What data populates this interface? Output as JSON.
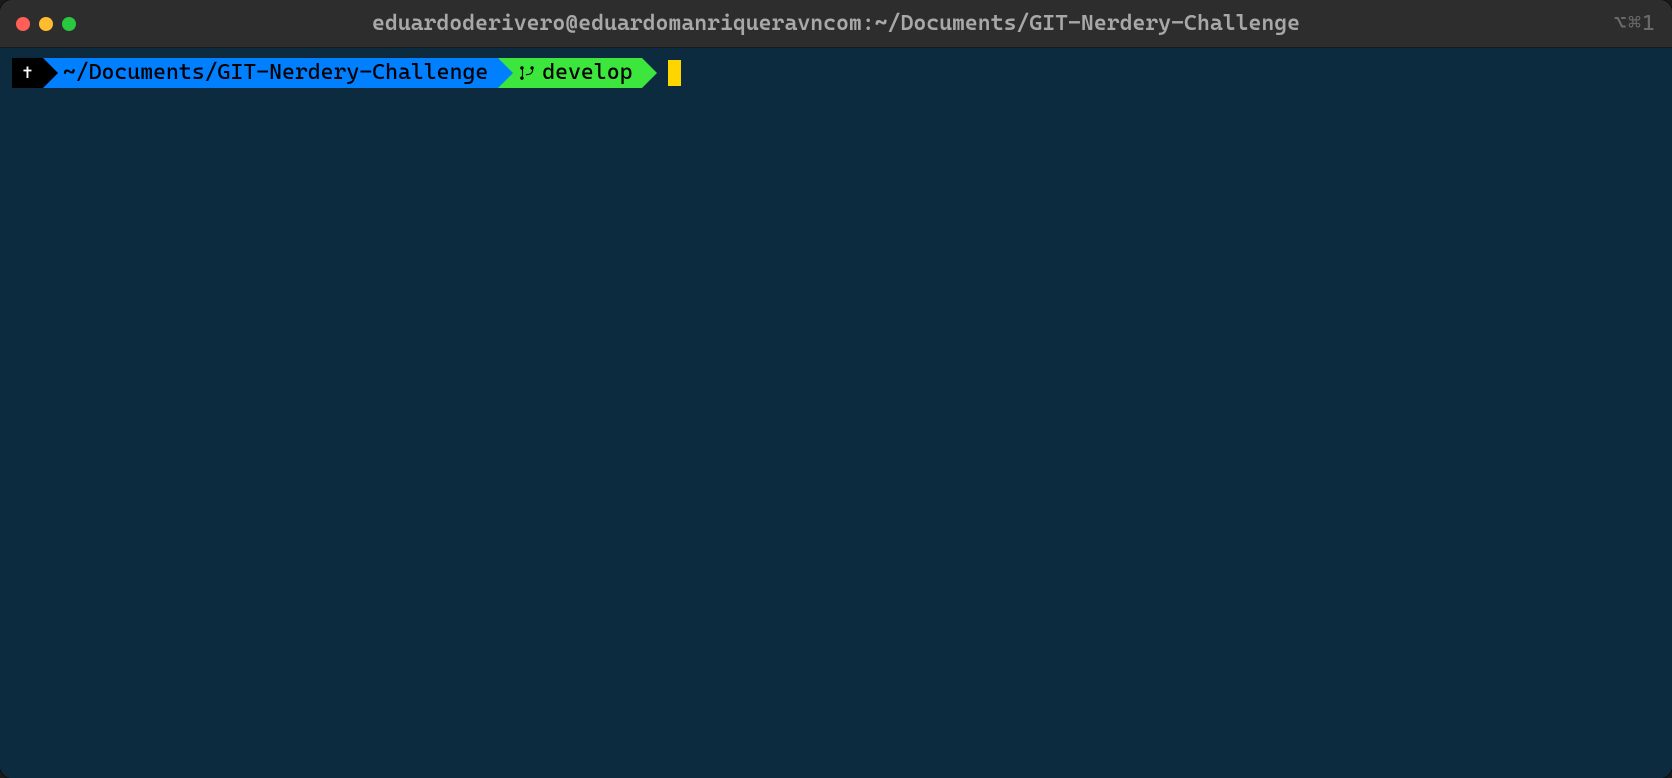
{
  "titlebar": {
    "title": "eduardoderivero@eduardomanriqueravncom:~/Documents/GIT-Nerdery-Challenge",
    "shortcut": "⌥⌘1"
  },
  "prompt": {
    "status_icon": "✝",
    "path": "~/Documents/GIT-Nerdery-Challenge",
    "branch": "develop"
  },
  "colors": {
    "bg": "#0d2b3e",
    "blue": "#007fff",
    "green": "#3ce63c",
    "cursor": "#ffd500"
  }
}
